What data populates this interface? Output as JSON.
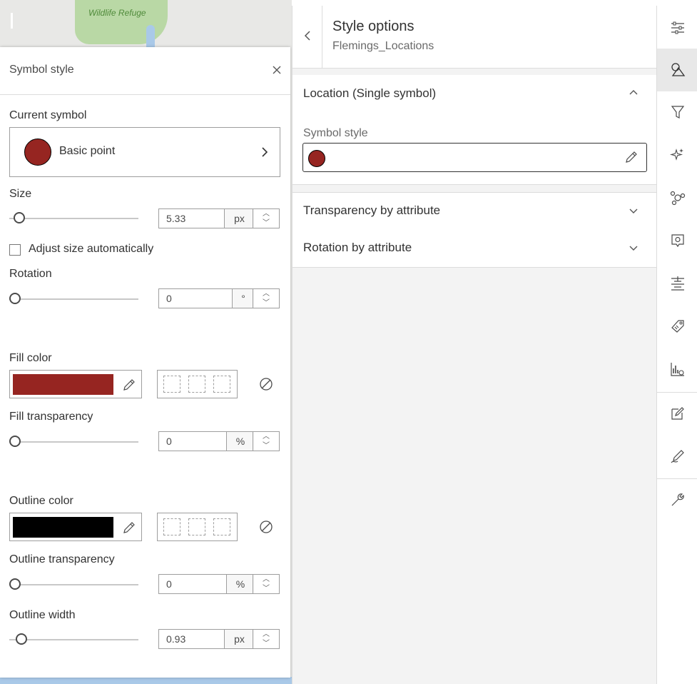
{
  "map": {
    "refuge_label": "Wildlife Refuge"
  },
  "symbol_panel": {
    "title": "Symbol style",
    "current_symbol": {
      "label": "Current symbol",
      "name": "Basic point",
      "color": "#962521"
    },
    "size": {
      "label": "Size",
      "value": "5.33",
      "unit": "px",
      "slider_fraction": 0.05
    },
    "adjust_size": {
      "label": "Adjust size automatically",
      "checked": false
    },
    "rotation": {
      "label": "Rotation",
      "value": "0",
      "unit": "°",
      "slider_fraction": 0.0
    },
    "fill_color": {
      "label": "Fill color",
      "color": "#962521"
    },
    "fill_transparency": {
      "label": "Fill transparency",
      "value": "0",
      "unit": "%",
      "slider_fraction": 0.0
    },
    "outline_color": {
      "label": "Outline color",
      "color": "#000000"
    },
    "outline_transparency": {
      "label": "Outline transparency",
      "value": "0",
      "unit": "%",
      "slider_fraction": 0.0
    },
    "outline_width": {
      "label": "Outline width",
      "value": "0.93",
      "unit": "px",
      "slider_fraction": 0.05
    }
  },
  "style_options": {
    "title": "Style options",
    "layer_name": "Flemings_Locations",
    "sections": {
      "location": {
        "title": "Location (Single symbol)",
        "expanded": true,
        "symbol_style_label": "Symbol style",
        "symbol_color": "#962521"
      },
      "transparency": {
        "title": "Transparency by attribute",
        "expanded": false
      },
      "rotation": {
        "title": "Rotation by attribute",
        "expanded": false
      }
    }
  },
  "toolbar": {
    "tools": [
      "properties-icon",
      "styles-icon",
      "filter-icon",
      "effects-icon",
      "clustering-icon",
      "pop-ups-icon",
      "labels-icon",
      "fields-icon",
      "charts-icon",
      "edit-icon",
      "sketch-icon",
      "configure-icon"
    ],
    "active": "styles-icon"
  }
}
